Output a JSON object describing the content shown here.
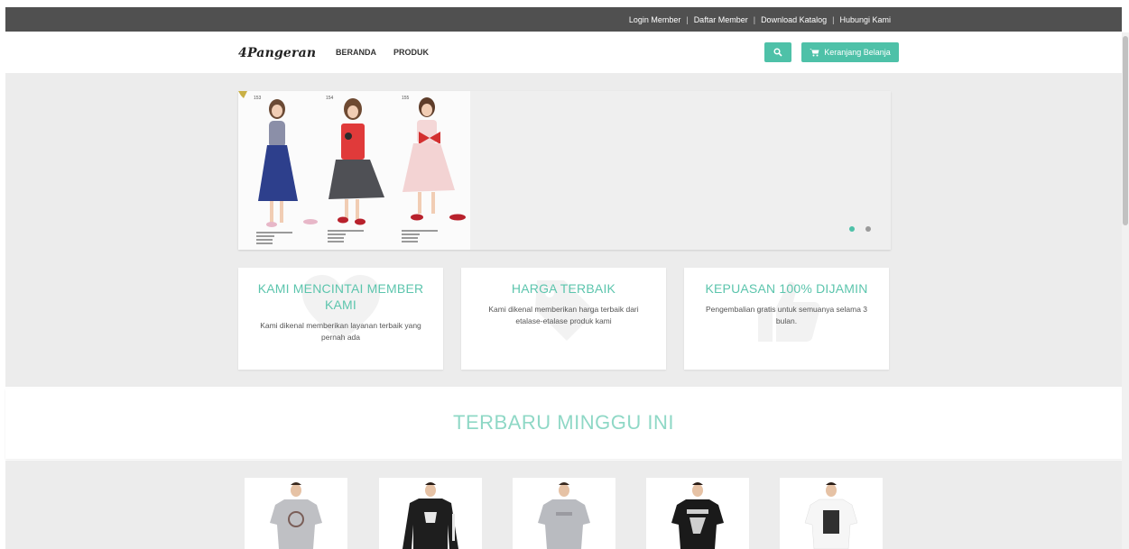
{
  "topbar": {
    "links": [
      "Login Member",
      "Daftar Member",
      "Download Katalog",
      "Hubungi Kami"
    ],
    "separator": "|"
  },
  "navbar": {
    "logo_text": "4Pangeran",
    "links": [
      "BERANDA",
      "PRODUK"
    ],
    "search_icon": "search-icon",
    "cart_icon": "cart-icon",
    "cart_label": "Keranjang Belanja"
  },
  "slider": {
    "slide_count": 2,
    "active_index": 0,
    "slide_codes": [
      "153",
      "154",
      "155"
    ]
  },
  "features": [
    {
      "title": "KAMI MENCINTAI MEMBER KAMI",
      "text": "Kami dikenal memberikan layanan terbaik yang pernah ada",
      "icon": "heart-icon"
    },
    {
      "title": "HARGA TERBAIK",
      "text": "Kami dikenal memberikan harga terbaik dari etalase-etalase produk kami",
      "icon": "tag-icon"
    },
    {
      "title": "KEPUASAN 100% DIJAMIN",
      "text": "Pengembalian gratis untuk semuanya selama 3 bulan.",
      "icon": "thumbs-up-icon"
    }
  ],
  "latest": {
    "title": "TERBARU MINGGU INI"
  },
  "products": [
    {
      "shirt_color": "#bfc0c4",
      "print": "#7a5e58"
    },
    {
      "shirt_color": "#1e1e1e",
      "print": "#e8e8e8"
    },
    {
      "shirt_color": "#b9bbc0",
      "print": "#9a9aa0"
    },
    {
      "shirt_color": "#1a1a1a",
      "print": "#cfcfcf"
    },
    {
      "shirt_color": "#f6f6f6",
      "print": "#303030"
    }
  ],
  "colors": {
    "accent": "#4ec1a8",
    "title": "#5cc5ad",
    "topbar": "#505050"
  }
}
